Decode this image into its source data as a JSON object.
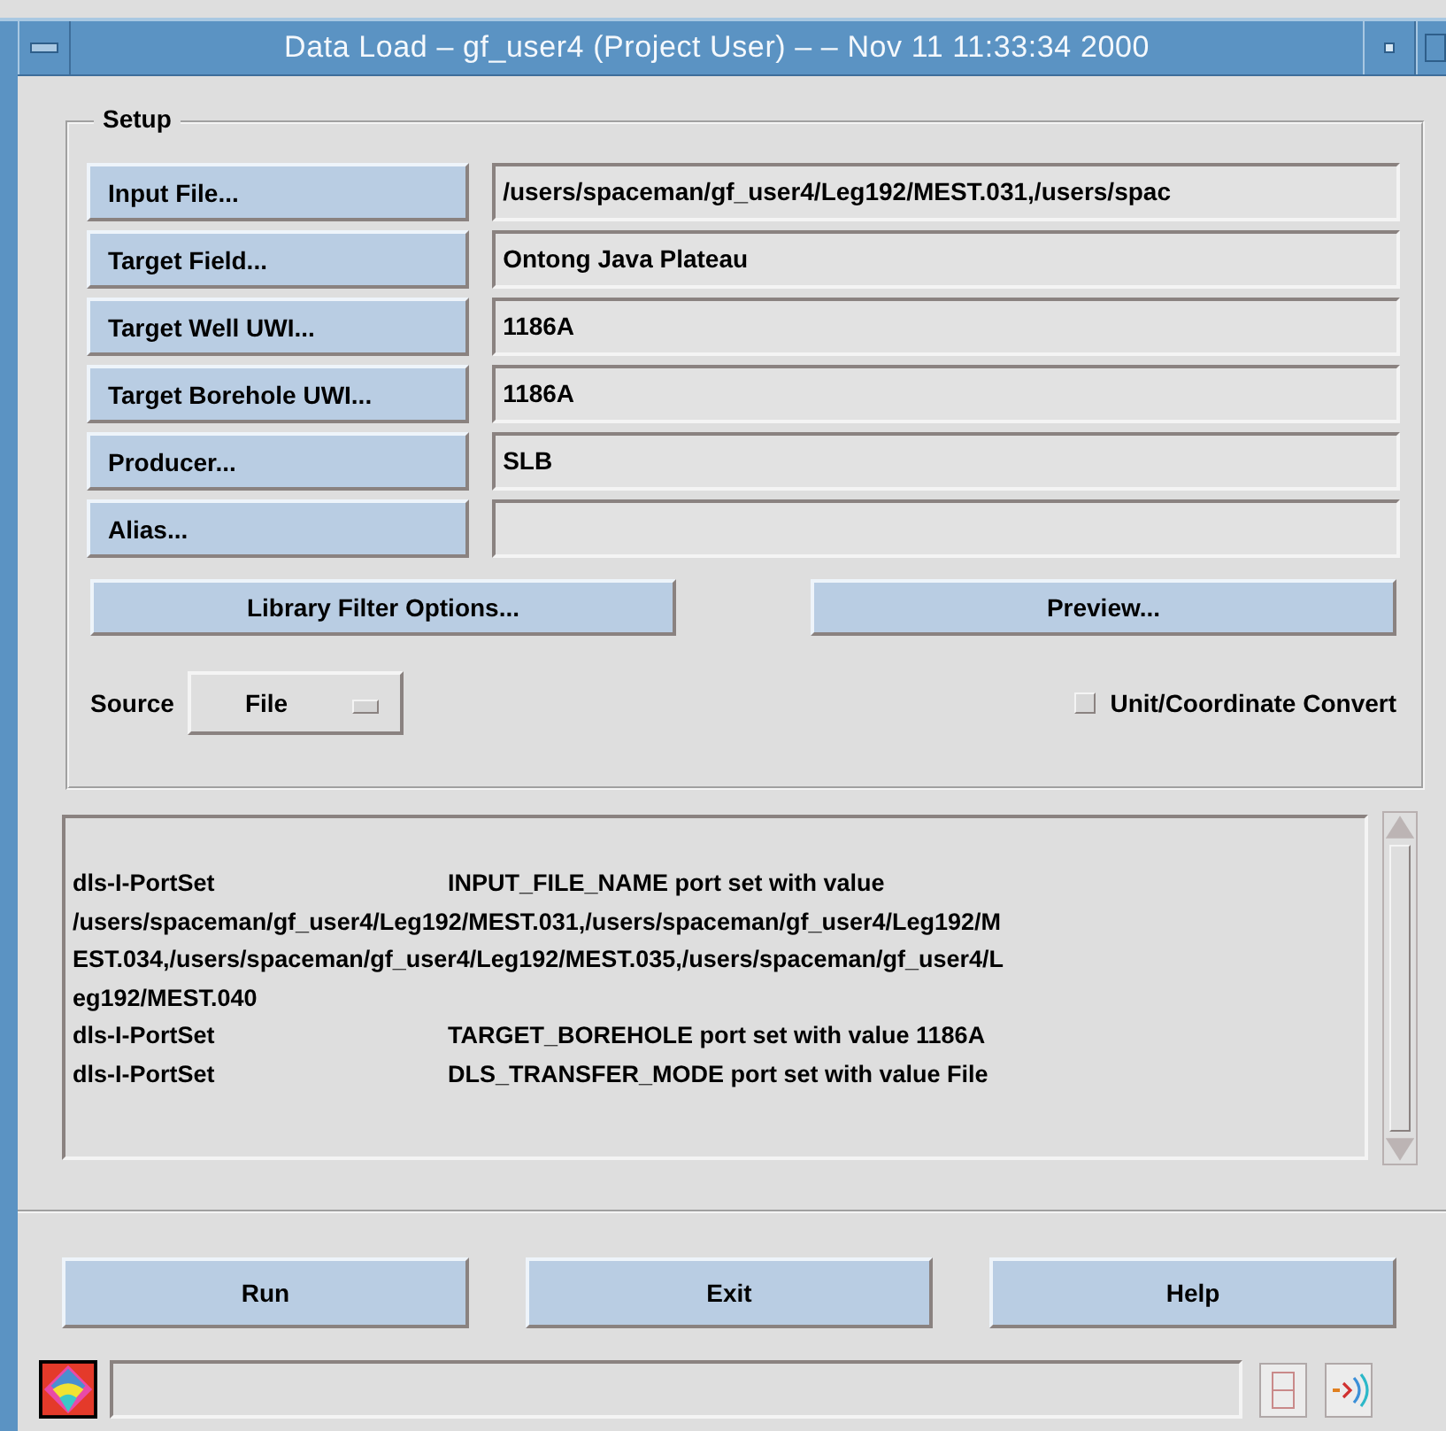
{
  "window": {
    "title": "Data Load – gf_user4  (Project User) – – Nov 11 11:33:34 2000"
  },
  "setup": {
    "title": "Setup",
    "fields": [
      {
        "button": "Input File...",
        "value": "/users/spaceman/gf_user4/Leg192/MEST.031,/users/spac"
      },
      {
        "button": "Target Field...",
        "value": "Ontong Java Plateau"
      },
      {
        "button": "Target Well UWI...",
        "value": "1186A"
      },
      {
        "button": "Target Borehole UWI...",
        "value": "1186A"
      },
      {
        "button": "Producer...",
        "value": "SLB"
      },
      {
        "button": "Alias..."
      }
    ],
    "actions": [
      "Library Filter Options...",
      "Preview..."
    ],
    "source": {
      "label": "Source",
      "value": "File"
    },
    "convert": {
      "label": "Unit/Coordinate Convert",
      "checked": false
    }
  },
  "log": [
    {
      "source": "dls-I-PortSet",
      "text": "INPUT_FILE_NAME port set with value"
    },
    {
      "text": "/users/spaceman/gf_user4/Leg192/MEST.031,/users/spaceman/gf_user4/Leg192/M"
    },
    {
      "text": "EST.034,/users/spaceman/gf_user4/Leg192/MEST.035,/users/spaceman/gf_user4/L"
    },
    {
      "text": "eg192/MEST.040"
    },
    {
      "source": "dls-I-PortSet",
      "text": "TARGET_BOREHOLE port set with value 1186A"
    },
    {
      "source": "dls-I-PortSet",
      "text": "DLS_TRANSFER_MODE port set with value File"
    }
  ],
  "buttons": [
    "Run",
    "Exit",
    "Help"
  ]
}
